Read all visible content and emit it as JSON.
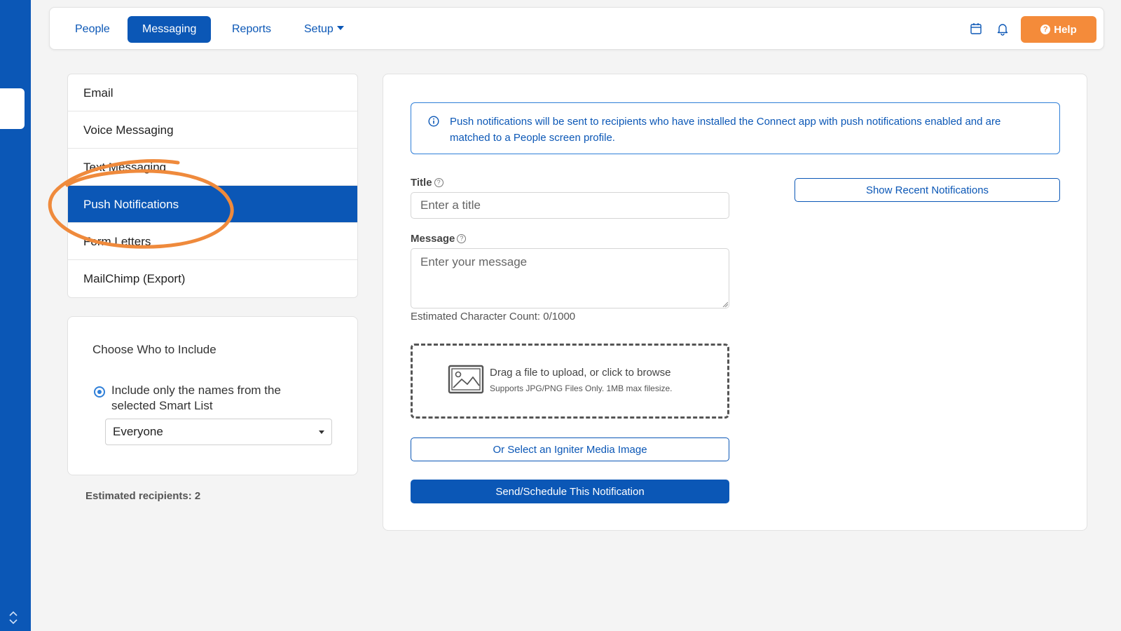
{
  "colors": {
    "brand_blue": "#0b57b6",
    "help_orange": "#f48b3a",
    "annotation_orange": "#ef8a3c",
    "page_bg": "#f4f4f4"
  },
  "topnav": {
    "items": [
      {
        "label": "People"
      },
      {
        "label": "Messaging"
      },
      {
        "label": "Reports"
      },
      {
        "label": "Setup"
      }
    ],
    "icons": [
      "calendar-icon",
      "bell-icon"
    ],
    "help_label": "Help"
  },
  "messaging_menu": {
    "items": [
      {
        "label": "Email"
      },
      {
        "label": "Voice Messaging"
      },
      {
        "label": "Text Messaging"
      },
      {
        "label": "Push Notifications"
      },
      {
        "label": "Form Letters"
      },
      {
        "label": "MailChimp (Export)"
      }
    ],
    "selected": "Push Notifications"
  },
  "include_panel": {
    "title": "Choose Who to Include",
    "radio_label": "Include only the names from the selected Smart List",
    "smart_list_value": "Everyone",
    "estimated_recipients": "Estimated recipients: 2"
  },
  "form": {
    "info_text": "Push notifications will be sent to recipients who have installed the Connect app with push notifications enabled and are matched to a People screen profile.",
    "title_label": "Title",
    "title_placeholder": "Enter a title",
    "message_label": "Message",
    "message_placeholder": "Enter your message",
    "char_count": "Estimated Character Count: 0/1000",
    "upload_main": "Drag a file to upload, or click to browse",
    "upload_sub": "Supports JPG/PNG Files Only. 1MB max filesize.",
    "igniter_button": "Or Select an Igniter Media Image",
    "send_button": "Send/Schedule This Notification",
    "recent_button": "Show Recent Notifications"
  }
}
